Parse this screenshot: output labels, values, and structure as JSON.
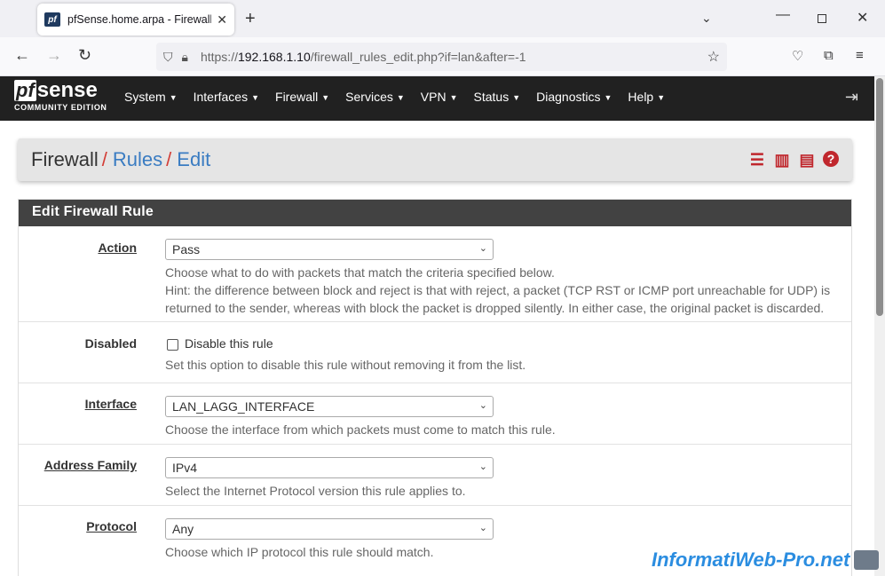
{
  "browser": {
    "tab_title": "pfSense.home.arpa - Firewall: R",
    "favicon_text": "pf",
    "new_tab": "+",
    "url_prefix": "https://",
    "url_host": "192.168.1.10",
    "url_path": "/firewall_rules_edit.php?if=lan&after=-1"
  },
  "logo": {
    "pf": "pf",
    "sense": "sense",
    "edition": "COMMUNITY EDITION"
  },
  "menu": [
    "System",
    "Interfaces",
    "Firewall",
    "Services",
    "VPN",
    "Status",
    "Diagnostics",
    "Help"
  ],
  "breadcrumb": {
    "first": "Firewall",
    "second": "Rules",
    "third": "Edit",
    "sep": "/"
  },
  "panel_title": "Edit Firewall Rule",
  "fields": {
    "action": {
      "label": "Action",
      "value": "Pass",
      "help1": "Choose what to do with packets that match the criteria specified below.",
      "help2": "Hint: the difference between block and reject is that with reject, a packet (TCP RST or ICMP port unreachable for UDP) is",
      "help3": "returned to the sender, whereas with block the packet is dropped silently. In either case, the original packet is discarded."
    },
    "disabled": {
      "label": "Disabled",
      "checkbox_label": "Disable this rule",
      "help": "Set this option to disable this rule without removing it from the list."
    },
    "interface": {
      "label": "Interface",
      "value": "LAN_LAGG_INTERFACE",
      "help": "Choose the interface from which packets must come to match this rule."
    },
    "address_family": {
      "label": "Address Family",
      "value": "IPv4",
      "help": "Select the Internet Protocol version this rule applies to."
    },
    "protocol": {
      "label": "Protocol",
      "value": "Any",
      "help": "Choose which IP protocol this rule should match."
    }
  },
  "watermark": "InformatiWeb-Pro.net",
  "colors": {
    "header_bg": "#212121",
    "accent_red": "#c0272d",
    "link_blue": "#3a7cc2",
    "panel_head": "#424242"
  }
}
